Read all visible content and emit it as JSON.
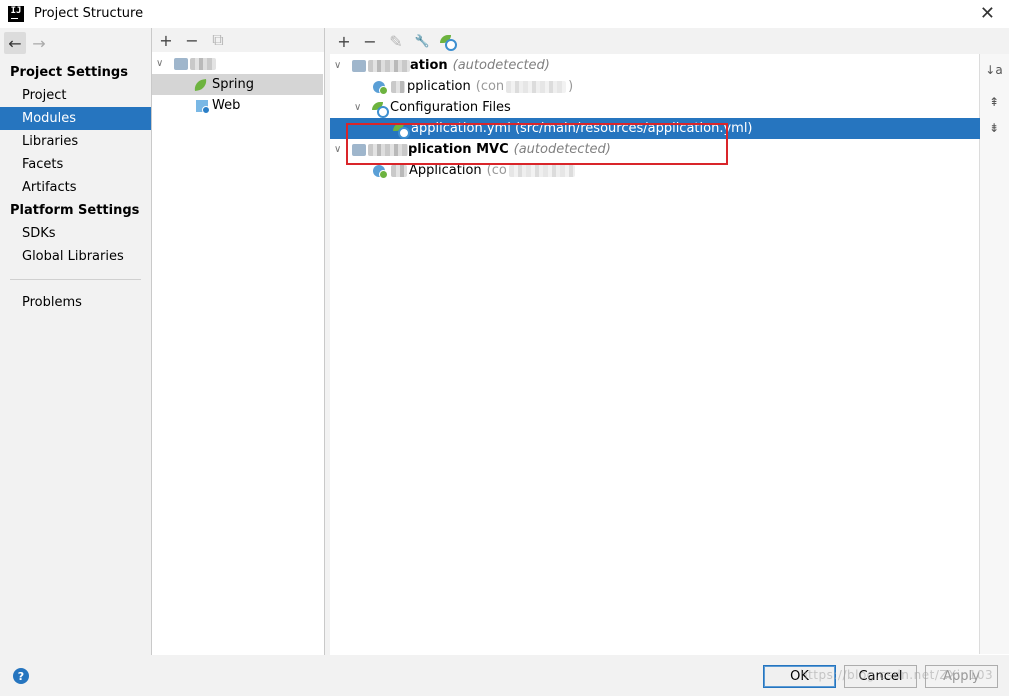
{
  "window": {
    "title": "Project Structure",
    "icon": "intellij-icon",
    "close": "✕"
  },
  "nav": {
    "back": "←",
    "forward": "→",
    "project_settings": "Project Settings",
    "project_items": [
      "Project",
      "Modules",
      "Libraries",
      "Facets",
      "Artifacts"
    ],
    "platform_settings": "Platform Settings",
    "platform_items": [
      "SDKs",
      "Global Libraries"
    ],
    "problems": "Problems",
    "selected": "Modules"
  },
  "modules_toolbar": {
    "add": "+",
    "remove": "−",
    "copy": "⧉"
  },
  "modules_tree": {
    "facets": [
      {
        "label": "Spring",
        "icon": "spring-leaf-icon"
      },
      {
        "label": "Web",
        "icon": "web-icon"
      }
    ]
  },
  "spring_toolbar": {
    "add": "+",
    "remove": "−",
    "edit": "✎",
    "settings": "🔧"
  },
  "spring_tree": {
    "group1": {
      "label_suffix": "ation",
      "note": "(autodetected)",
      "child_label": "pplication",
      "child_paren_open": "(con",
      "child_paren_close": ")"
    },
    "config_files": {
      "label": "Configuration Files",
      "file": "application.yml (src/main/resources/application.yml)"
    },
    "group2": {
      "label_suffix": "plication MVC",
      "note": "(autodetected)",
      "child_label": "Application",
      "child_paren_open": "(co"
    }
  },
  "side_tools": {
    "sort": "↓a",
    "expand": "⇞",
    "collapse": "⇟"
  },
  "footer": {
    "help": "?",
    "ok": "OK",
    "cancel": "Cancel",
    "apply": "Apply",
    "watermark": "https://blog.csdn.net/ZXin103"
  },
  "colors": {
    "selection": "#2675bf",
    "highlight_box": "#d9252a",
    "spring_green": "#6db33f"
  }
}
